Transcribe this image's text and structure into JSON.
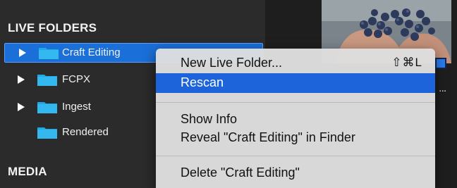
{
  "sidebar": {
    "live_folders_header": "LIVE FOLDERS",
    "media_header": "MEDIA",
    "items": [
      {
        "label": "Craft Editing",
        "has_disclosure": true,
        "selected": true
      },
      {
        "label": "FCPX",
        "has_disclosure": true,
        "selected": false
      },
      {
        "label": "Ingest",
        "has_disclosure": true,
        "selected": false
      },
      {
        "label": "Rendered",
        "has_disclosure": false,
        "selected": false
      }
    ]
  },
  "context_menu": {
    "items": [
      {
        "label": "New Live Folder...",
        "shortcut": "⇧⌘L"
      },
      {
        "label": "Rescan"
      },
      {
        "label": "Show Info"
      },
      {
        "label": "Reveal \"Craft Editing\" in Finder"
      },
      {
        "label": "Delete \"Craft Editing\""
      }
    ],
    "highlighted_item": "Rescan"
  },
  "media_panel": {
    "more_indicator": "..."
  },
  "colors": {
    "selection_blue": "#1a6fd8",
    "menu_highlight": "#1d63d9",
    "folder_blue": "#1fa9e6"
  }
}
